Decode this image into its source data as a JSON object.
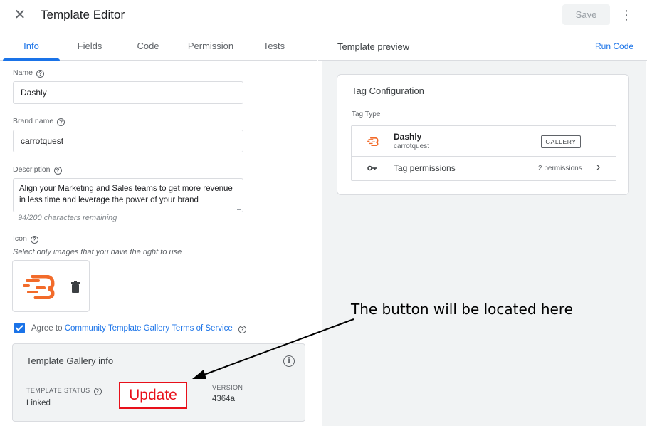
{
  "header": {
    "close_icon": "close-icon",
    "title": "Template Editor",
    "save_label": "Save",
    "more_icon": "more-vert-icon"
  },
  "tabs": [
    {
      "label": "Info",
      "active": true
    },
    {
      "label": "Fields",
      "active": false
    },
    {
      "label": "Code",
      "active": false
    },
    {
      "label": "Permission",
      "active": false
    },
    {
      "label": "Tests",
      "active": false
    }
  ],
  "form": {
    "name_label": "Name",
    "name_value": "Dashly",
    "brand_label": "Brand name",
    "brand_value": "carrotquest",
    "description_label": "Description",
    "description_value": "Align your Marketing and Sales teams to get more revenue in less time and leverage the power of your brand",
    "chars_remaining": "94/200 characters remaining",
    "icon_label": "Icon",
    "icon_hint": "Select only images that you have the right to use",
    "agree_checked": true,
    "agree_prefix": "Agree to",
    "agree_link": "Community Template Gallery Terms of Service"
  },
  "gallery_info": {
    "title": "Template Gallery info",
    "status_label": "TEMPLATE STATUS",
    "status_value": "Linked",
    "version_label": "VERSION",
    "version_value": "4364a",
    "update_label": "Update"
  },
  "preview": {
    "title": "Template preview",
    "run_code": "Run Code",
    "config_title": "Tag Configuration",
    "tag_type_label": "Tag Type",
    "tag_name": "Dashly",
    "tag_brand": "carrotquest",
    "gallery_badge": "GALLERY",
    "permissions_label": "Tag permissions",
    "permissions_count": "2 permissions"
  },
  "annotation": {
    "text": "The button will be located here"
  },
  "colors": {
    "accent": "#1a73e8",
    "brand_logo": "#f26b2a",
    "annotation_red": "#e8101a"
  }
}
